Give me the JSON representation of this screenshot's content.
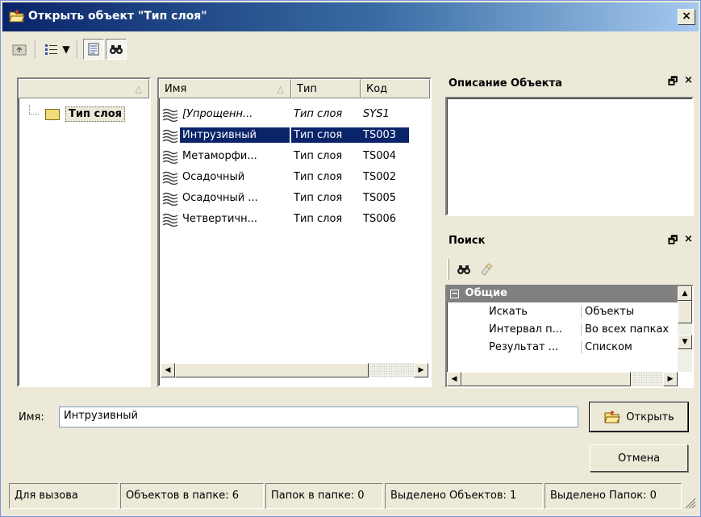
{
  "window": {
    "title": "Открыть объект \"Тип слоя\"",
    "close_glyph": "×"
  },
  "toolbar": {
    "view_dropdown_glyph": "▼"
  },
  "tree": {
    "root_label": "Тип слоя"
  },
  "list": {
    "headers": {
      "name": "Имя",
      "type": "Тип",
      "code": "Код"
    },
    "rows": [
      {
        "name": "[Упрощенн...",
        "type": "Тип слоя",
        "code": "SYS1",
        "italic": true,
        "selected": false
      },
      {
        "name": "Интрузивный",
        "type": "Тип слоя",
        "code": "TS003",
        "italic": false,
        "selected": true
      },
      {
        "name": "Метаморфи...",
        "type": "Тип слоя",
        "code": "TS004",
        "italic": false,
        "selected": false
      },
      {
        "name": "Осадочный",
        "type": "Тип слоя",
        "code": "TS002",
        "italic": false,
        "selected": false
      },
      {
        "name": "Осадочный ...",
        "type": "Тип слоя",
        "code": "TS005",
        "italic": false,
        "selected": false
      },
      {
        "name": "Четвертичн...",
        "type": "Тип слоя",
        "code": "TS006",
        "italic": false,
        "selected": false
      }
    ]
  },
  "description_panel": {
    "title": "Описание Объекта",
    "float_glyph": "🗗",
    "close_glyph": "×"
  },
  "search_panel": {
    "title": "Поиск",
    "float_glyph": "🗗",
    "close_glyph": "×",
    "group_label": "Общие",
    "group_toggle": "−",
    "properties": [
      {
        "key": "Искать",
        "value": "Объекты"
      },
      {
        "key": "Интервал п...",
        "value": "Во всех папках"
      },
      {
        "key": "Результат ...",
        "value": "Списком"
      }
    ]
  },
  "name_field": {
    "label": "Имя:",
    "value": "Интрузивный"
  },
  "buttons": {
    "open": "Открыть",
    "cancel": "Отмена"
  },
  "status": {
    "hint": "Для вызова",
    "objects_in_folder": "Объектов в папке: 6",
    "folders_in_folder": "Папок в папке: 0",
    "selected_objects": "Выделено Объектов: 1",
    "selected_folders": "Выделено Папок: 0"
  },
  "colors": {
    "selection": "#0a246a",
    "face": "#ece9d8",
    "group_header": "#808080"
  }
}
